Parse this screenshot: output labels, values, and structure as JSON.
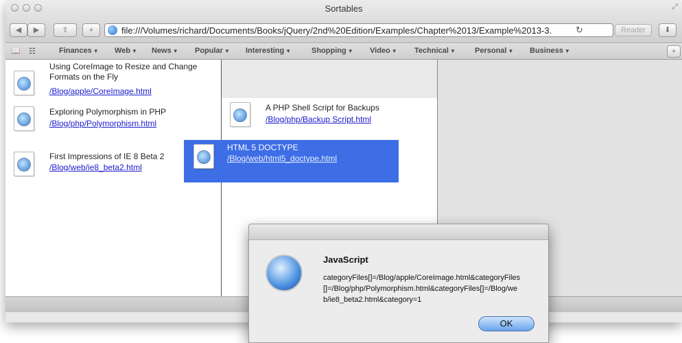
{
  "window": {
    "title": "Sortables"
  },
  "toolbar": {
    "back_icon": "◀",
    "forward_icon": "▶",
    "share_icon": "⇪",
    "add_icon": "+",
    "address": "file:///Volumes/richard/Documents/Books/jQuery/2nd%20Edition/Examples/Chapter%2013/Example%2013-3.",
    "reload_icon": "↻",
    "reader_label": "Reader",
    "download_icon": "⬇"
  },
  "bookmarks": {
    "book_icon": "📖",
    "grid_icon": "☷",
    "items": [
      {
        "label": "Finances"
      },
      {
        "label": "Web"
      },
      {
        "label": "News"
      },
      {
        "label": "Popular"
      },
      {
        "label": "Interesting"
      },
      {
        "label": "Shopping"
      },
      {
        "label": "Video"
      },
      {
        "label": "Technical"
      },
      {
        "label": "Personal"
      },
      {
        "label": "Business"
      }
    ],
    "new_tab_icon": "+"
  },
  "column1": {
    "files": [
      {
        "title": "Using CoreImage to Resize and Change Formats on the Fly",
        "link": "/Blog/apple/CoreImage.html"
      },
      {
        "title": "Exploring Polymorphism in PHP",
        "link": "/Blog/php/Polymorphism.html"
      },
      {
        "title": "First Impressions of IE 8 Beta 2",
        "link": "/Blog/web/ie8_beta2.html"
      }
    ]
  },
  "column2": {
    "files": [
      {
        "title": "A PHP Shell Script for Backups",
        "link": "/Blog/php/Backup Script.html"
      }
    ]
  },
  "dragging": {
    "title": "HTML 5 DOCTYPE",
    "link": "/Blog/web/html5_doctype.html"
  },
  "dialog": {
    "heading": "JavaScript",
    "message": "categoryFiles[]=/Blog/apple/CoreImage.html&categoryFiles[]=/Blog/php/Polymorphism.html&categoryFiles[]=/Blog/web/ie8_beta2.html&category=1",
    "ok_label": "OK"
  }
}
